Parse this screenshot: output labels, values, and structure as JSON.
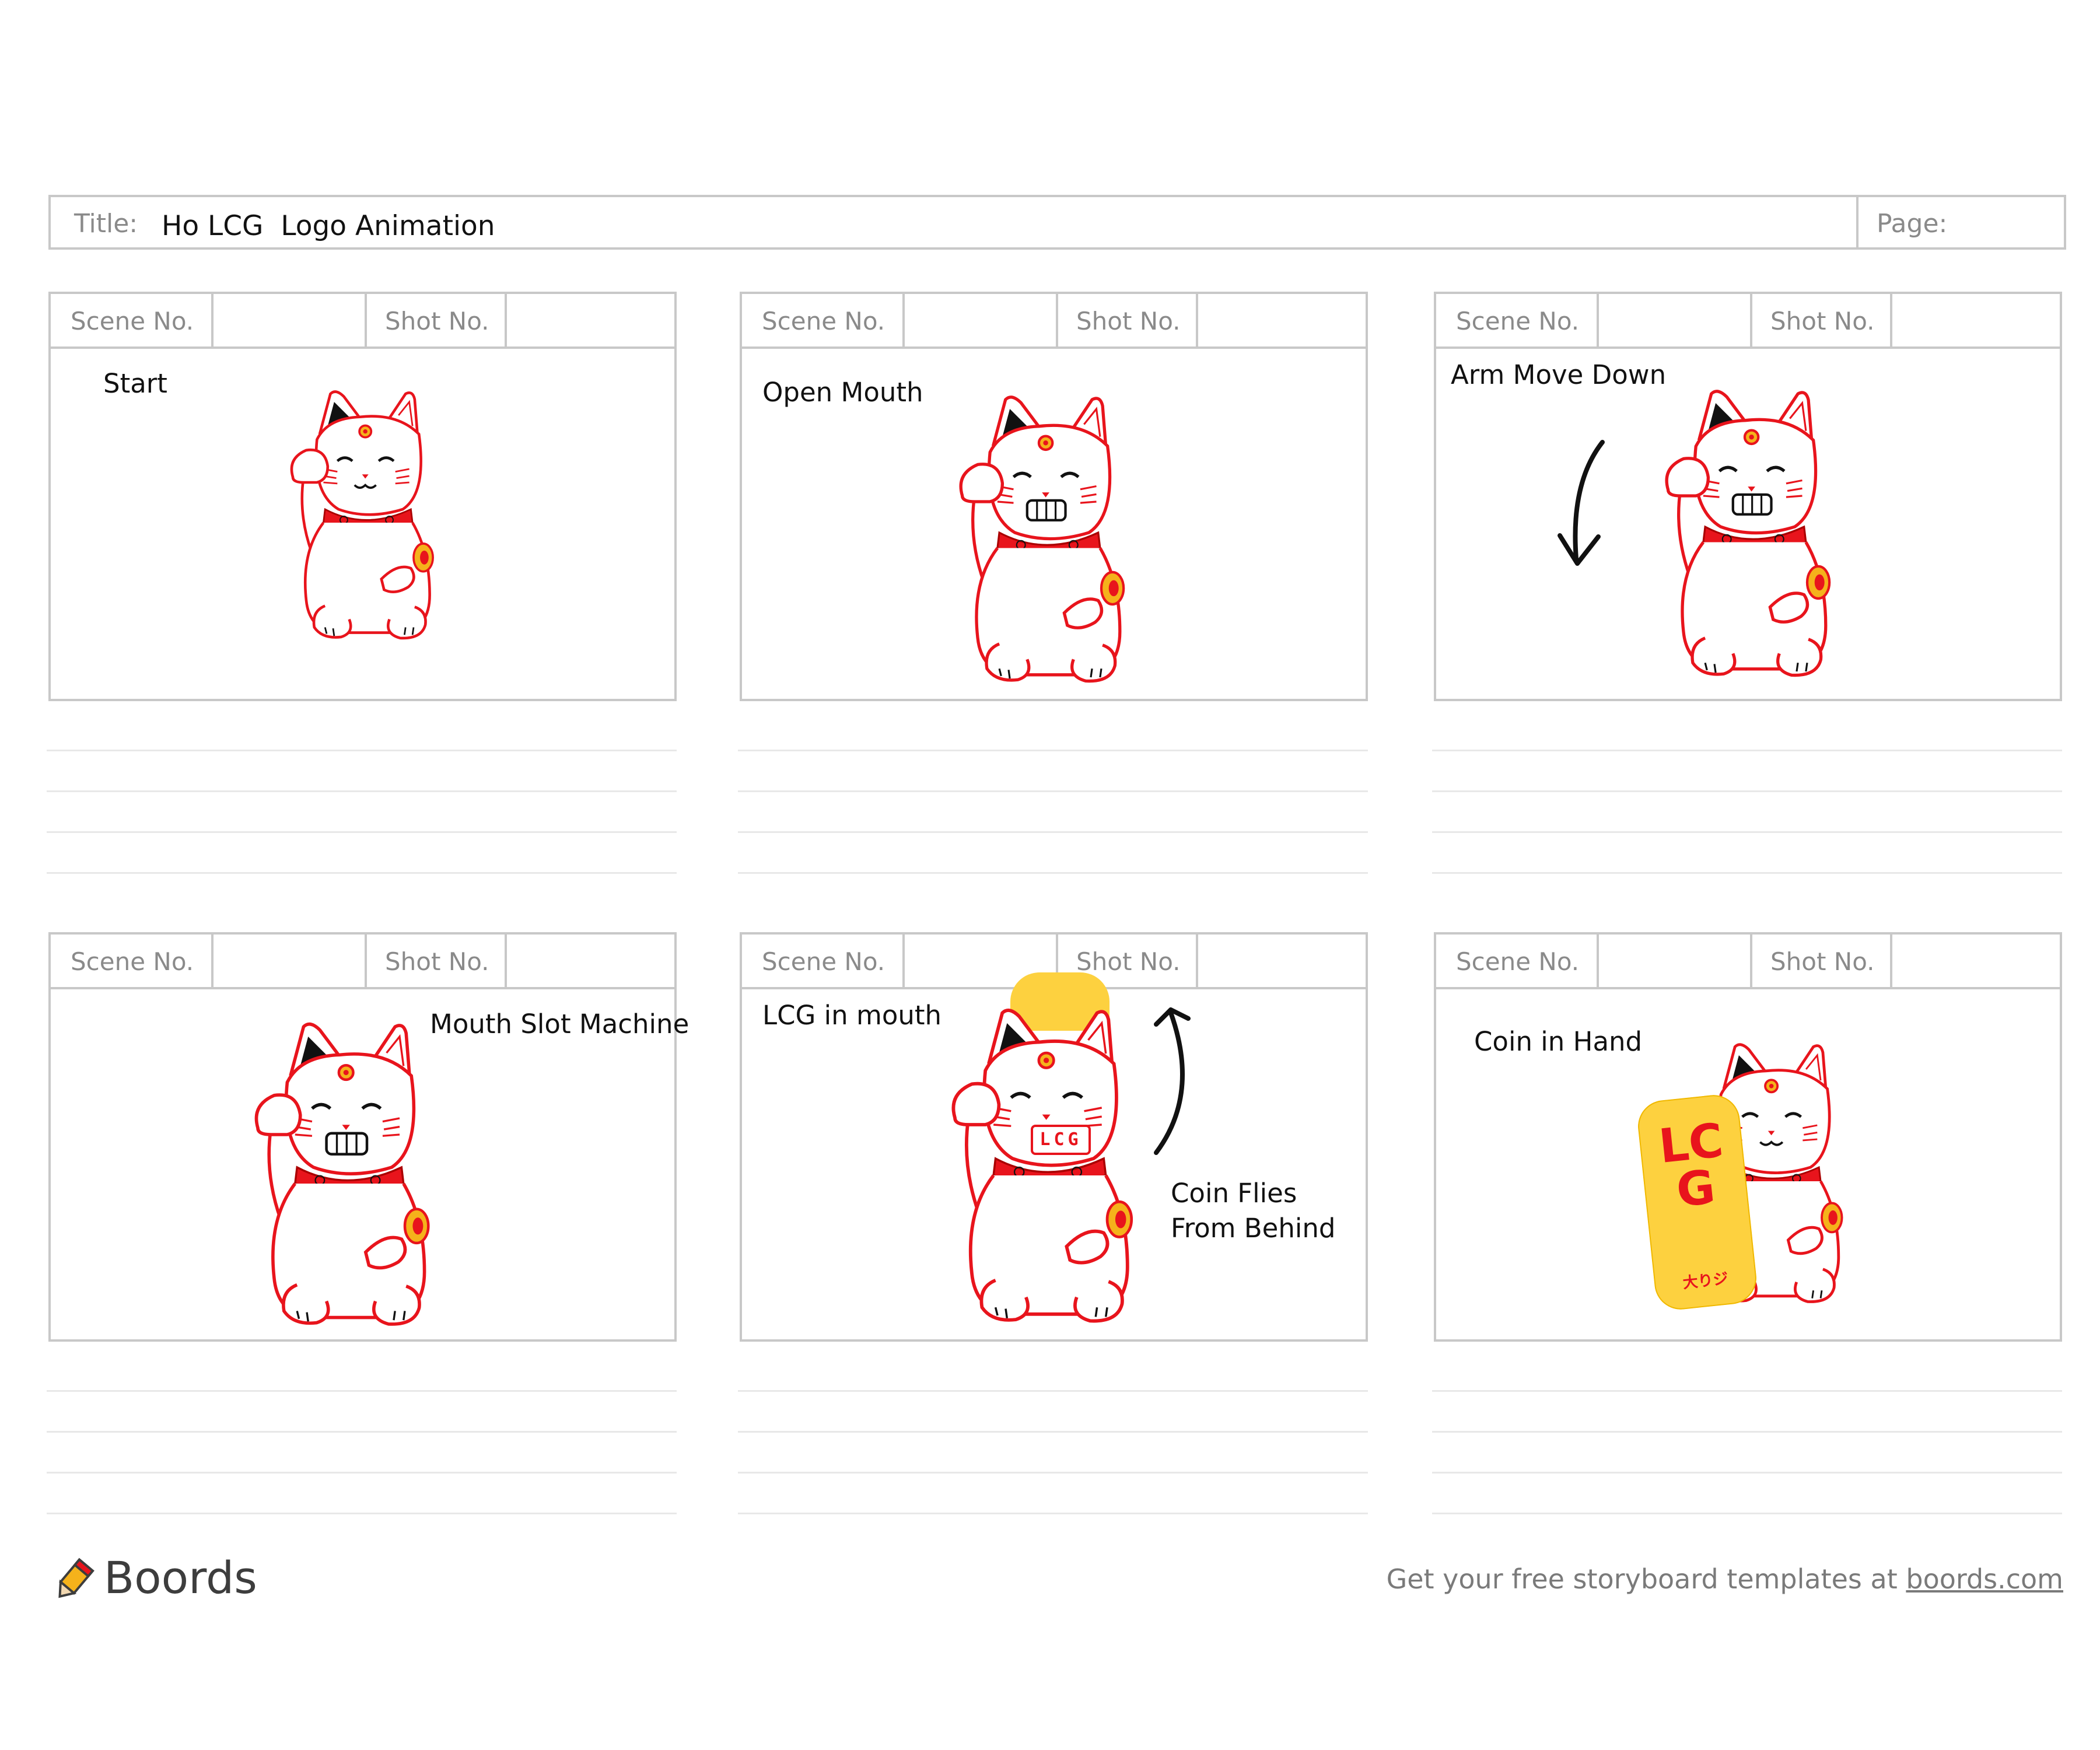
{
  "header": {
    "title_label": "Title:",
    "title_value": "Ho LCG  Logo Animation",
    "page_label": "Page:"
  },
  "panels": [
    {
      "scene_label": "Scene No.",
      "shot_label": "Shot No.",
      "caption": "Start"
    },
    {
      "scene_label": "Scene No.",
      "shot_label": "Shot No.",
      "caption": "Open Mouth"
    },
    {
      "scene_label": "Scene No.",
      "shot_label": "Shot No.",
      "caption": "Arm Move Down"
    },
    {
      "scene_label": "Scene No.",
      "shot_label": "Shot No.",
      "caption": "Mouth Slot Machine"
    },
    {
      "scene_label": "Scene No.",
      "shot_label": "Shot No.",
      "caption": "LCG in mouth",
      "note": "Coin Flies\nFrom Behind",
      "mouth_text": "LCG"
    },
    {
      "scene_label": "Scene No.",
      "shot_label": "Shot No.",
      "caption": "Coin in Hand",
      "coin_text": "LCG",
      "coin_sub": "大りジ"
    }
  ],
  "footer": {
    "brand": "Boords",
    "note_text": "Get your free storyboard templates at ",
    "note_link": "boords.com"
  },
  "colors": {
    "cat_outline": "#e8141c",
    "ear": "#111111",
    "gold": "#f5b21b",
    "coin_yellow": "#fdd13f",
    "frame_border": "#c8c8c8"
  }
}
